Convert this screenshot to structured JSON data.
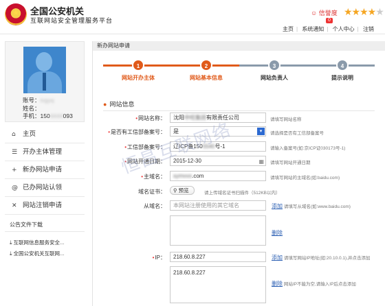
{
  "header": {
    "org_title": "全国公安机关",
    "org_subtitle": "互联网站安全管理服务平台",
    "credit_label": "信誉度",
    "credit_badge": "0",
    "stars_full": "★★★★",
    "stars_empty": "★",
    "nav": [
      {
        "label": "主页"
      },
      {
        "label": "系统通知"
      },
      {
        "label": "个人中心"
      },
      {
        "label": "注销"
      }
    ]
  },
  "profile": {
    "account_label": "账号：",
    "account_value": "ivgyq",
    "name_label": "姓名：",
    "name_value": "",
    "phone_label": "手机：",
    "phone_prefix": "150",
    "phone_hidden": "4444",
    "phone_suffix": "093"
  },
  "menu": {
    "items": [
      {
        "label": "主页",
        "icon": "home-icon",
        "glyph": "⌂"
      },
      {
        "label": "开办主体管理",
        "icon": "list-icon",
        "glyph": "☰"
      },
      {
        "label": "新办网站申请",
        "icon": "plus-icon",
        "glyph": "+"
      },
      {
        "label": "已办网站认领",
        "icon": "at-icon",
        "glyph": "@"
      },
      {
        "label": "网站注销申请",
        "icon": "close-icon",
        "glyph": "✕"
      }
    ],
    "notice_title": "公告文件下载",
    "notices": [
      {
        "label": "互联网信息服务安全..."
      },
      {
        "label": "全国公安机关互联网..."
      }
    ]
  },
  "breadcrumb": "新办网站申请",
  "steps": [
    {
      "number": "1",
      "label": "网站开办主体",
      "state": "done"
    },
    {
      "number": "2",
      "label": "网站基本信息",
      "state": "active"
    },
    {
      "number": "3",
      "label": "网站负责人",
      "state": "pending"
    },
    {
      "number": "4",
      "label": "提示说明",
      "state": "pending"
    }
  ],
  "section_title": "网站信息",
  "form": {
    "site_name": {
      "label": "网站名称：",
      "value_prefix": "沈阳",
      "value_hidden": "中旺集团",
      "value_suffix": "有限责任公司",
      "hint": "请填写网站名称"
    },
    "has_icp": {
      "label": "是否有工信部备案号：",
      "value": "是",
      "hint": "请选择是否有工信部备案号"
    },
    "icp_number": {
      "label": "工信部备案号：",
      "value_prefix": "辽ICP备150",
      "value_hidden": "5540",
      "value_suffix": "号-1",
      "hint": "请输入备案号(如:京ICP证030173号-1)"
    },
    "open_date": {
      "label": "网站开通日期：",
      "value": "2015-12-30",
      "hint": "请填写网站开通日期"
    },
    "domain": {
      "label": "主域名：",
      "value_hidden": "symvvo",
      "value_suffix": ".com",
      "hint": "请填写网站的主域名(如:baidu.com)"
    },
    "domain_cert": {
      "label": "域名证书：",
      "button": "预览",
      "hint": "请上传域名证书扫描件（512KB以内）"
    },
    "sub_domain": {
      "label": "从域名：",
      "placeholder": "本网站注册使用的其它域名",
      "add": "添加",
      "hint": "请填写从域名(如:www.baidu.com)",
      "delete": "删除"
    },
    "ip": {
      "label": "IP：",
      "value": "218.60.8.227",
      "add": "添加",
      "hint": "请填写网站IP地址(如:20.10.0.1),并点击添加",
      "list_value": "218.60.8.227",
      "delete": "删除",
      "list_hint": "网站IP不能为空,请输入IP后点击添加"
    }
  },
  "watermark": "恒昌互联网络",
  "colors": {
    "accent": "#e05a1a",
    "pending": "#8a9aaa",
    "link": "#2b5fb3",
    "required": "#e33333"
  }
}
